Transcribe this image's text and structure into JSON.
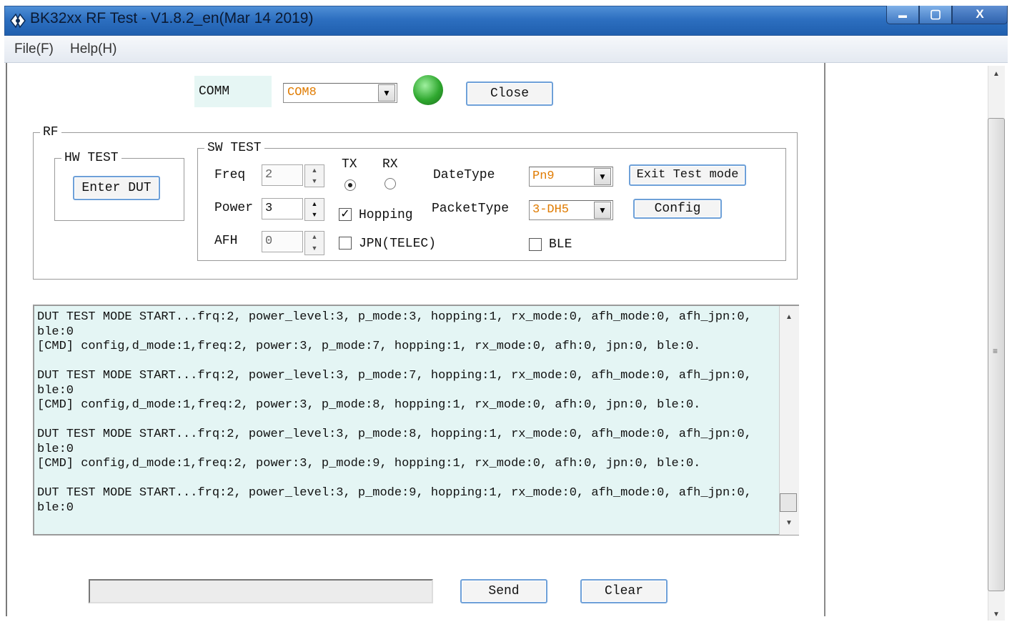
{
  "window": {
    "title": "BK32xx RF Test - V1.8.2_en(Mar 14 2019)",
    "min_glyph": "▬",
    "max_glyph": "▢",
    "close_glyph": "X"
  },
  "menu": [
    {
      "label": "File(F)"
    },
    {
      "label": "Help(H)"
    }
  ],
  "comm": {
    "label": "COMM",
    "port": "COM8",
    "status_color": "#2fa82f",
    "close_button": "Close"
  },
  "rf": {
    "title": "RF",
    "hw_test": {
      "title": "HW TEST",
      "enter_dut": "Enter DUT"
    },
    "sw_test": {
      "title": "SW TEST",
      "freq_label": "Freq",
      "freq_value": "2",
      "power_label": "Power",
      "power_value": "3",
      "afh_label": "AFH",
      "afh_value": "0",
      "tx_label": "TX",
      "rx_label": "RX",
      "mode_selected": "TX",
      "hopping_label": "Hopping",
      "hopping_checked": true,
      "jpn_label": "JPN(TELEC)",
      "jpn_checked": false,
      "datatype_label": "DateType",
      "datatype_value": "Pn9",
      "packettype_label": "PacketType",
      "packettype_value": "3-DH5",
      "ble_label": "BLE",
      "ble_checked": false,
      "exit_test_mode": "Exit Test mode",
      "config": "Config"
    }
  },
  "log": {
    "lines": [
      "DUT TEST MODE START...frq:2, power_level:3, p_mode:3, hopping:1, rx_mode:0, afh_mode:0, afh_jpn:0,",
      "ble:0",
      "[CMD] config,d_mode:1,freq:2, power:3, p_mode:7, hopping:1, rx_mode:0, afh:0, jpn:0, ble:0.",
      "",
      "DUT TEST MODE START...frq:2, power_level:3, p_mode:7, hopping:1, rx_mode:0, afh_mode:0, afh_jpn:0,",
      "ble:0",
      "[CMD] config,d_mode:1,freq:2, power:3, p_mode:8, hopping:1, rx_mode:0, afh:0, jpn:0, ble:0.",
      "",
      "DUT TEST MODE START...frq:2, power_level:3, p_mode:8, hopping:1, rx_mode:0, afh_mode:0, afh_jpn:0,",
      "ble:0",
      "[CMD] config,d_mode:1,freq:2, power:3, p_mode:9, hopping:1, rx_mode:0, afh:0, jpn:0, ble:0.",
      "",
      "DUT TEST MODE START...frq:2, power_level:3, p_mode:9, hopping:1, rx_mode:0, afh_mode:0, afh_jpn:0,",
      "ble:0"
    ]
  },
  "bottom": {
    "input_value": "",
    "send": "Send",
    "clear": "Clear"
  }
}
